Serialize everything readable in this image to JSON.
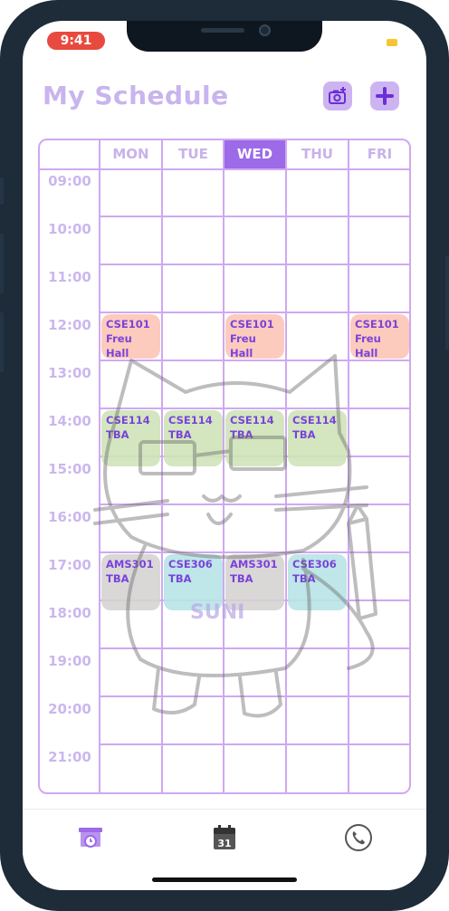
{
  "status_bar": {
    "time": "9:41"
  },
  "header": {
    "title": "My Schedule"
  },
  "days": [
    {
      "label": "MON",
      "active": false
    },
    {
      "label": "TUE",
      "active": false
    },
    {
      "label": "WED",
      "active": true
    },
    {
      "label": "THU",
      "active": false
    },
    {
      "label": "FRI",
      "active": false
    }
  ],
  "times": [
    "09:00",
    "10:00",
    "11:00",
    "12:00",
    "13:00",
    "14:00",
    "15:00",
    "16:00",
    "17:00",
    "18:00",
    "19:00",
    "20:00",
    "21:00"
  ],
  "events": [
    {
      "course": "CSE101",
      "location": "Freu Hall",
      "day": 0,
      "start": 12,
      "end": 13,
      "color": "#fcc6b8"
    },
    {
      "course": "CSE101",
      "location": "Freu Hall",
      "day": 2,
      "start": 12,
      "end": 13,
      "color": "#fcc6b8"
    },
    {
      "course": "CSE101",
      "location": "Freu Hall",
      "day": 4,
      "start": 12,
      "end": 13,
      "color": "#fcc6b8"
    },
    {
      "course": "CSE114",
      "location": "TBA",
      "day": 0,
      "start": 14,
      "end": 15.25,
      "color": "#cfe4b9"
    },
    {
      "course": "CSE114",
      "location": "TBA",
      "day": 1,
      "start": 14,
      "end": 15.25,
      "color": "#cfe4b9"
    },
    {
      "course": "CSE114",
      "location": "TBA",
      "day": 2,
      "start": 14,
      "end": 15.25,
      "color": "#cfe4b9"
    },
    {
      "course": "CSE114",
      "location": "TBA",
      "day": 3,
      "start": 14,
      "end": 15.25,
      "color": "#cfe4b9"
    },
    {
      "course": "AMS301",
      "location": "TBA",
      "day": 0,
      "start": 17,
      "end": 18.25,
      "color": "#d6d3d3"
    },
    {
      "course": "CSE306",
      "location": "TBA",
      "day": 1,
      "start": 17,
      "end": 18.25,
      "color": "#b9e4e6"
    },
    {
      "course": "AMS301",
      "location": "TBA",
      "day": 2,
      "start": 17,
      "end": 18.25,
      "color": "#d6d3d3"
    },
    {
      "course": "CSE306",
      "location": "TBA",
      "day": 3,
      "start": 17,
      "end": 18.25,
      "color": "#b9e4e6"
    }
  ],
  "mascot": {
    "text": "SUNI"
  },
  "tabbar": {
    "items": [
      {
        "icon": "schedule-alarm-icon"
      },
      {
        "icon": "calendar-icon",
        "text": "31"
      },
      {
        "icon": "phone-icon"
      }
    ]
  },
  "colors": {
    "accent": "#9d6ae8",
    "grid": "#cfa8f3",
    "title": "#c9b4ee",
    "status_pill": "#e84a3f"
  }
}
